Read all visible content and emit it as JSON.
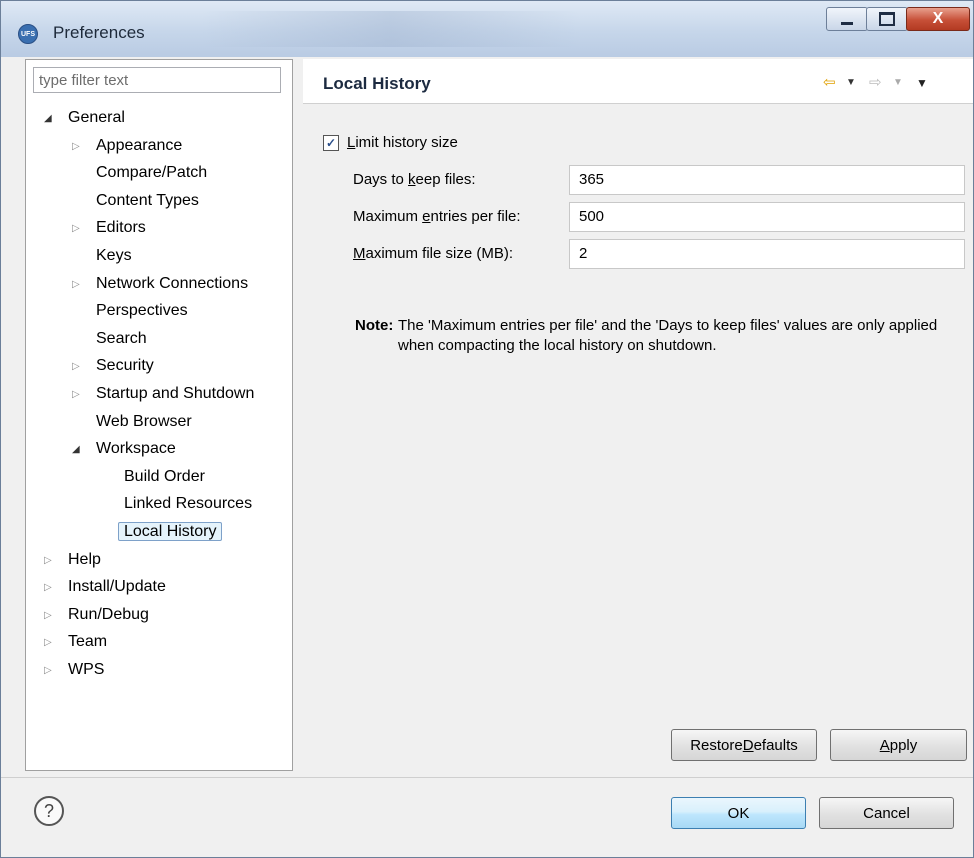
{
  "window": {
    "title": "Preferences",
    "app_icon_text": "UFS",
    "close_glyph": "X"
  },
  "left_panel": {
    "filter_placeholder": "type filter text",
    "tree": [
      {
        "label": "General",
        "level": 0,
        "arrow": "expanded"
      },
      {
        "label": "Appearance",
        "level": 1,
        "arrow": "collapsed"
      },
      {
        "label": "Compare/Patch",
        "level": 1,
        "arrow": "none"
      },
      {
        "label": "Content Types",
        "level": 1,
        "arrow": "none"
      },
      {
        "label": "Editors",
        "level": 1,
        "arrow": "collapsed"
      },
      {
        "label": "Keys",
        "level": 1,
        "arrow": "none"
      },
      {
        "label": "Network Connections",
        "level": 1,
        "arrow": "collapsed"
      },
      {
        "label": "Perspectives",
        "level": 1,
        "arrow": "none"
      },
      {
        "label": "Search",
        "level": 1,
        "arrow": "none"
      },
      {
        "label": "Security",
        "level": 1,
        "arrow": "collapsed"
      },
      {
        "label": "Startup and Shutdown",
        "level": 1,
        "arrow": "collapsed"
      },
      {
        "label": "Web Browser",
        "level": 1,
        "arrow": "none"
      },
      {
        "label": "Workspace",
        "level": 1,
        "arrow": "expanded"
      },
      {
        "label": "Build Order",
        "level": 2,
        "arrow": "none"
      },
      {
        "label": "Linked Resources",
        "level": 2,
        "arrow": "none"
      },
      {
        "label": "Local History",
        "level": 2,
        "arrow": "none",
        "selected": true
      },
      {
        "label": "Help",
        "level": 0,
        "arrow": "collapsed"
      },
      {
        "label": "Install/Update",
        "level": 0,
        "arrow": "collapsed"
      },
      {
        "label": "Run/Debug",
        "level": 0,
        "arrow": "collapsed"
      },
      {
        "label": "Team",
        "level": 0,
        "arrow": "collapsed"
      },
      {
        "label": "WPS",
        "level": 0,
        "arrow": "collapsed"
      }
    ]
  },
  "page": {
    "title": "Local History",
    "limit_checkbox": {
      "checked": true,
      "label_underlined": "L",
      "label_rest": "imit history size"
    },
    "fields": [
      {
        "label_pre": "Days to ",
        "label_u": "k",
        "label_post": "eep files:",
        "value": "365"
      },
      {
        "label_pre": "Maximum ",
        "label_u": "e",
        "label_post": "ntries per file:",
        "value": "500"
      },
      {
        "label_pre": "",
        "label_u": "M",
        "label_post": "aximum file size (MB):",
        "value": "2"
      }
    ],
    "note_label": "Note:",
    "note_text": "The 'Maximum entries per file' and the 'Days to keep files' values are only applied when compacting the local history on shutdown.",
    "restore_defaults": {
      "pre": "Restore ",
      "u": "D",
      "post": "efaults"
    },
    "apply": {
      "pre": "",
      "u": "A",
      "post": "pply"
    }
  },
  "footer": {
    "help_glyph": "?",
    "ok_label": "OK",
    "cancel_label": "Cancel"
  },
  "colors": {
    "selection_bg": "#e5f3fb",
    "selection_border": "#7ea1c9",
    "back_arrow": "#e0a000"
  }
}
